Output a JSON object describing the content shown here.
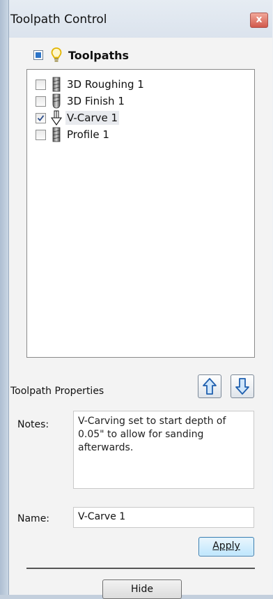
{
  "window": {
    "title": "Toolpath Control",
    "close_glyph": "x"
  },
  "tree": {
    "title": "Toolpaths",
    "root_icon": "lightbulb-icon",
    "items": [
      {
        "label": "3D Roughing 1",
        "checked": false,
        "icon": "end-mill-icon"
      },
      {
        "label": "3D Finish 1",
        "checked": false,
        "icon": "ball-nose-icon"
      },
      {
        "label": "V-Carve 1",
        "checked": true,
        "selected": true,
        "icon": "v-bit-icon"
      },
      {
        "label": "Profile 1",
        "checked": false,
        "icon": "end-mill-icon"
      }
    ]
  },
  "properties": {
    "section_label": "Toolpath Properties",
    "notes_label": "Notes:",
    "notes_value": "V-Carving set to start depth of 0.05\" to allow for sanding afterwards.",
    "name_label": "Name:",
    "name_value": "V-Carve 1",
    "apply_label": "Apply",
    "hide_label": "Hide"
  },
  "colors": {
    "accent_blue": "#2b73c7",
    "bulb": "#e2b400",
    "close_red": "#d1584b"
  }
}
